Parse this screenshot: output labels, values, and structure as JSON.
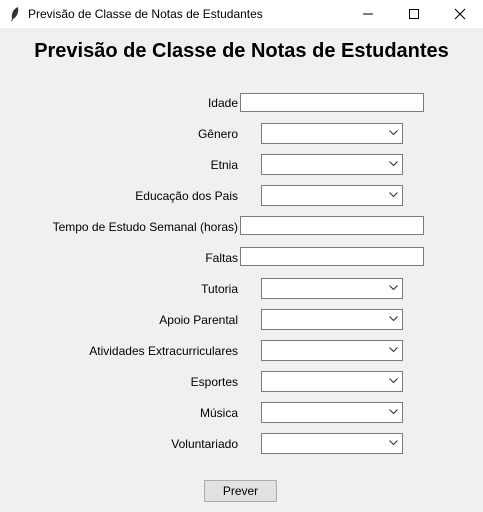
{
  "window": {
    "title": "Previsão de Classe de Notas de Estudantes",
    "icon": "feather-icon",
    "controls": [
      "minimize-icon",
      "maximize-icon",
      "close-icon"
    ]
  },
  "heading": "Previsão de Classe de Notas de Estudantes",
  "fields": {
    "idade": {
      "label": "Idade",
      "value": ""
    },
    "genero": {
      "label": "Gênero",
      "value": ""
    },
    "etnia": {
      "label": "Etnia",
      "value": ""
    },
    "educacao_pais": {
      "label": "Educação dos Pais",
      "value": ""
    },
    "tempo_estudo": {
      "label": "Tempo de Estudo Semanal (horas)",
      "value": ""
    },
    "faltas": {
      "label": "Faltas",
      "value": ""
    },
    "tutoria": {
      "label": "Tutoria",
      "value": ""
    },
    "apoio_parental": {
      "label": "Apoio Parental",
      "value": ""
    },
    "atividades_extracurriculares": {
      "label": "Atividades Extracurriculares",
      "value": ""
    },
    "esportes": {
      "label": "Esportes",
      "value": ""
    },
    "musica": {
      "label": "Música",
      "value": ""
    },
    "voluntariado": {
      "label": "Voluntariado",
      "value": ""
    }
  },
  "predict_button": "Prever"
}
